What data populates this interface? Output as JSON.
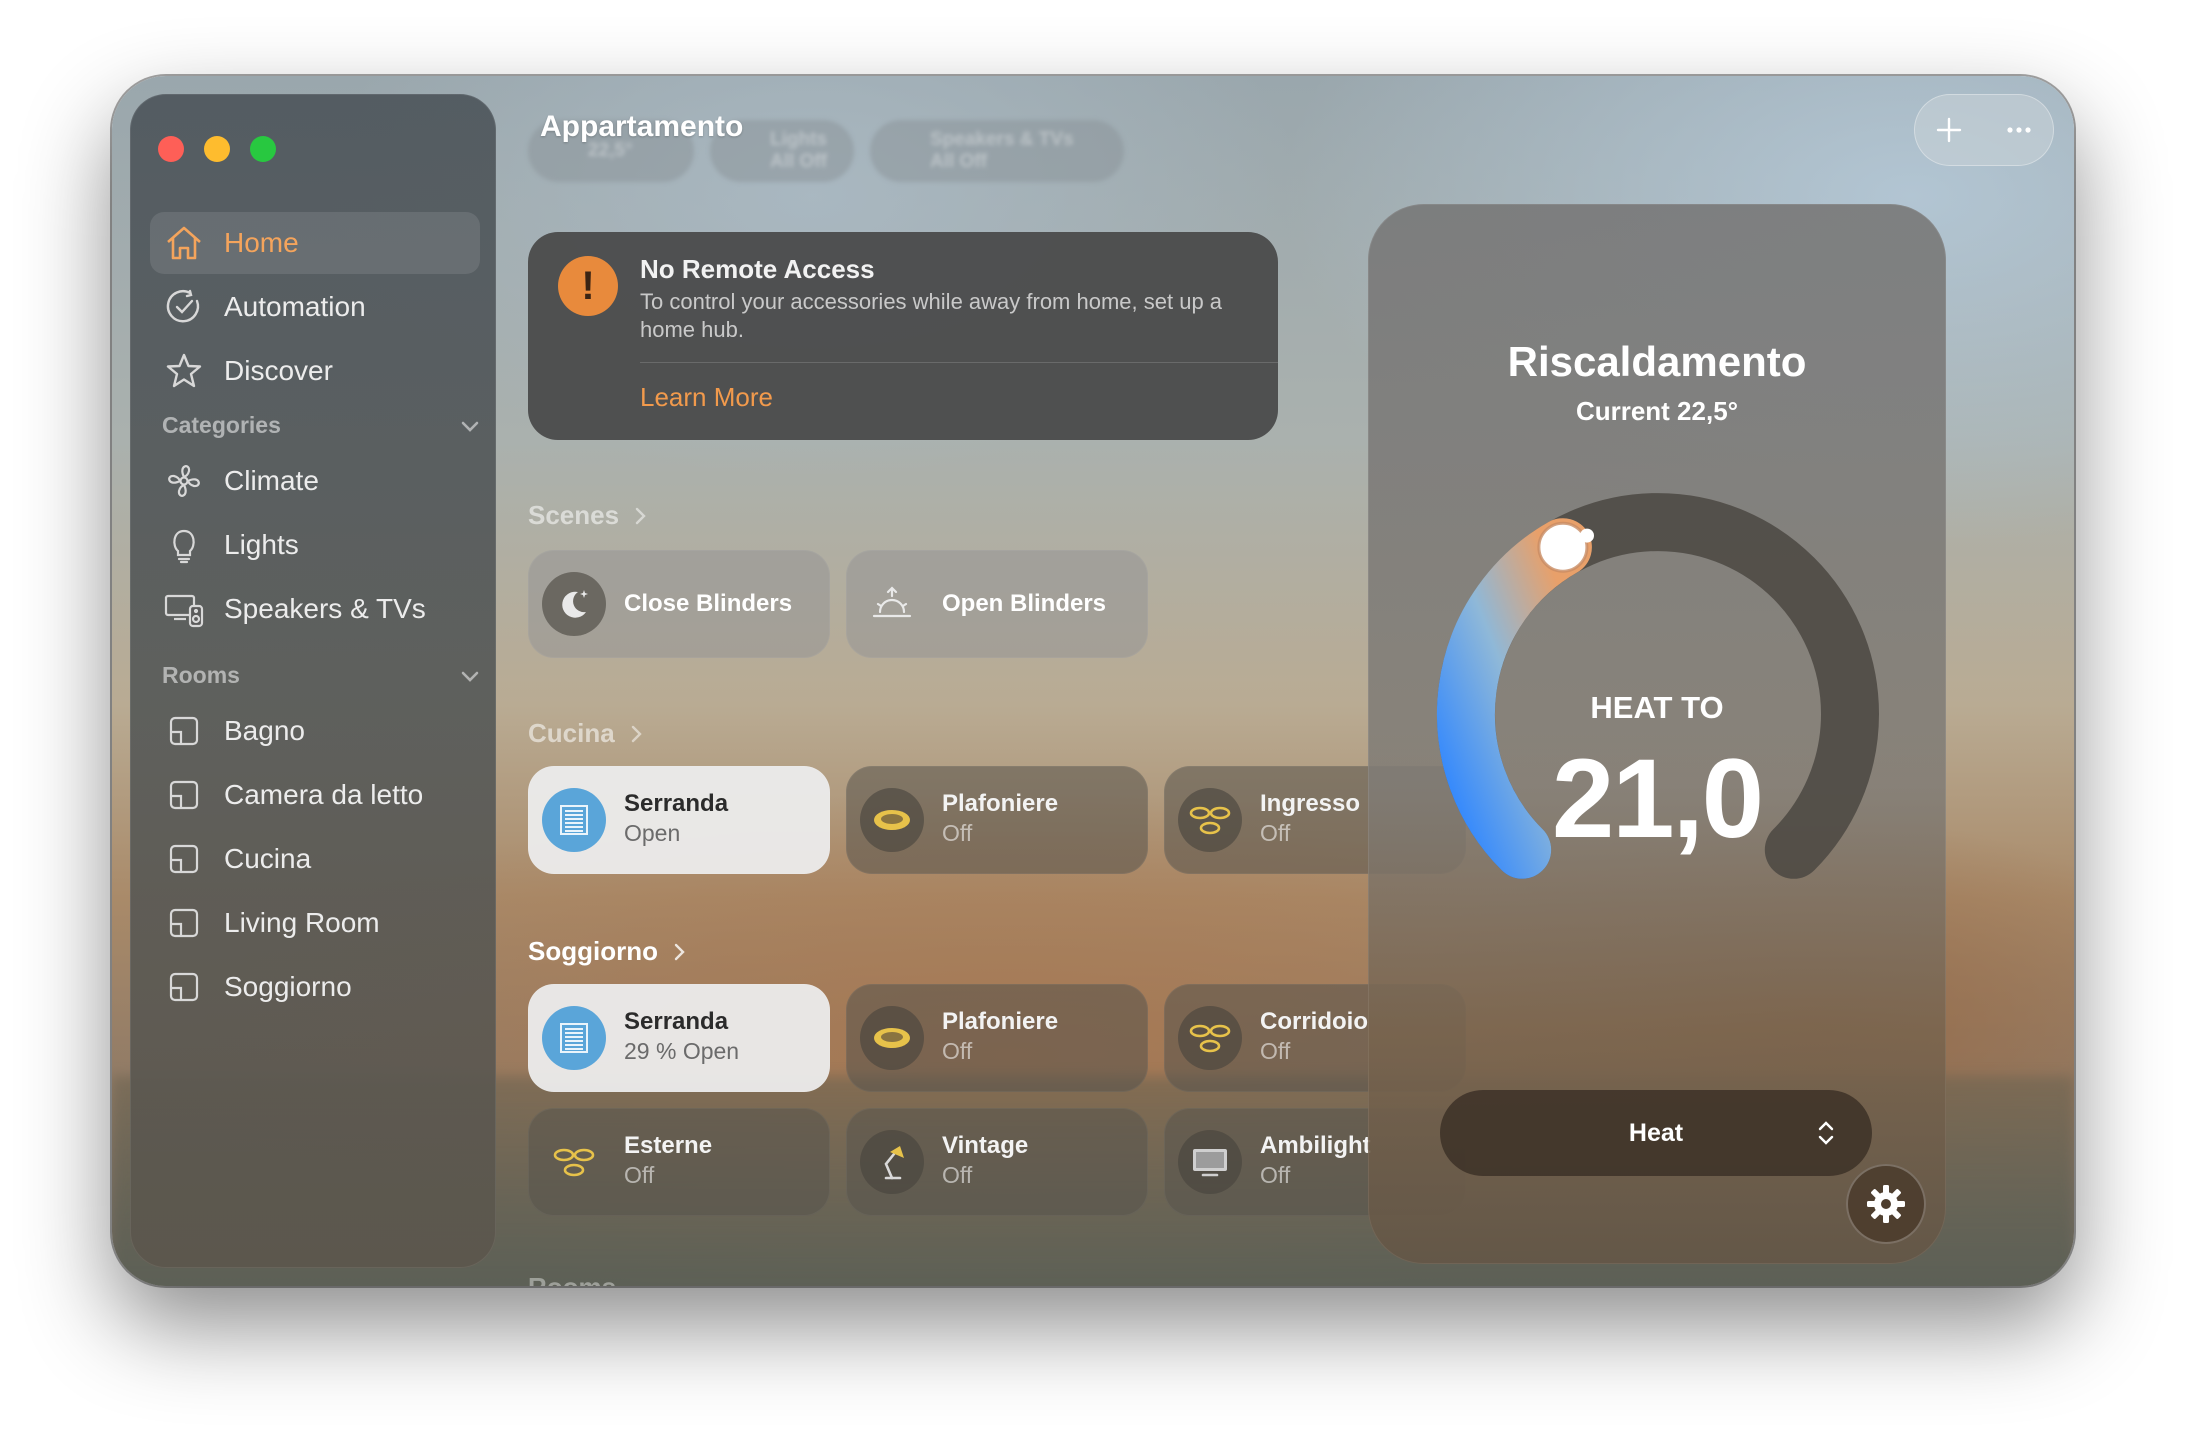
{
  "window": {
    "title": "Appartamento",
    "ghost_pills": [
      {
        "label": "22,5°"
      },
      {
        "label": "Lights\nAll Off"
      },
      {
        "label": "Speakers & TVs\nAll Off"
      }
    ]
  },
  "sidebar": {
    "primary": [
      {
        "label": "Home",
        "icon": "home-icon",
        "active": true
      },
      {
        "label": "Automation",
        "icon": "automation-clock-icon"
      },
      {
        "label": "Discover",
        "icon": "star-icon"
      }
    ],
    "categories_header": "Categories",
    "categories": [
      {
        "label": "Climate",
        "icon": "fan-icon"
      },
      {
        "label": "Lights",
        "icon": "lightbulb-icon"
      },
      {
        "label": "Speakers & TVs",
        "icon": "speakers-tv-icon"
      }
    ],
    "rooms_header": "Rooms",
    "rooms": [
      {
        "label": "Bagno",
        "icon": "room-icon"
      },
      {
        "label": "Camera da letto",
        "icon": "room-icon"
      },
      {
        "label": "Cucina",
        "icon": "room-icon"
      },
      {
        "label": "Living Room",
        "icon": "room-icon"
      },
      {
        "label": "Soggiorno",
        "icon": "room-icon"
      }
    ]
  },
  "remote_access": {
    "title": "No Remote Access",
    "body": "To control your accessories while away from home, set up a home hub.",
    "link": "Learn More"
  },
  "scenes": {
    "label": "Scenes",
    "items": [
      {
        "name": "Close Blinders",
        "icon": "moon-icon"
      },
      {
        "name": "Open Blinders",
        "icon": "sunrise-icon"
      }
    ]
  },
  "cucina": {
    "label": "Cucina",
    "tiles": [
      {
        "name": "Serranda",
        "state": "Open",
        "icon": "blinds-icon",
        "on": true
      },
      {
        "name": "Plafoniere",
        "state": "Off",
        "icon": "ceiling-light-icon"
      },
      {
        "name": "Ingresso",
        "state": "Off",
        "icon": "spotlights-icon"
      }
    ]
  },
  "soggiorno": {
    "label": "Soggiorno",
    "tiles": [
      {
        "name": "Serranda",
        "state": "29 % Open",
        "icon": "blinds-icon",
        "on": true
      },
      {
        "name": "Plafoniere",
        "state": "Off",
        "icon": "ceiling-light-icon"
      },
      {
        "name": "Corridoio",
        "state": "Off",
        "icon": "spotlights-icon"
      },
      {
        "name": "Esterne",
        "state": "Off",
        "icon": "spotlights-icon"
      },
      {
        "name": "Vintage",
        "state": "Off",
        "icon": "desk-lamp-icon"
      },
      {
        "name": "Ambilight",
        "state": "Off",
        "icon": "tv-icon"
      }
    ]
  },
  "next_section_label": "Rooms",
  "thermostat": {
    "name": "Riscaldamento",
    "current": "Current 22,5°",
    "heat_to_label": "HEAT TO",
    "setpoint": "21,0",
    "mode": "Heat",
    "dial_fraction": 0.39
  },
  "colors": {
    "accent": "#f4a45c",
    "warning": "#e88a3c",
    "blinds_blue": "#5aa5d9",
    "light_icon_yellow": "#e7c24a",
    "dial_cold": "#2f86ff",
    "dial_warm": "#e8a06a"
  }
}
